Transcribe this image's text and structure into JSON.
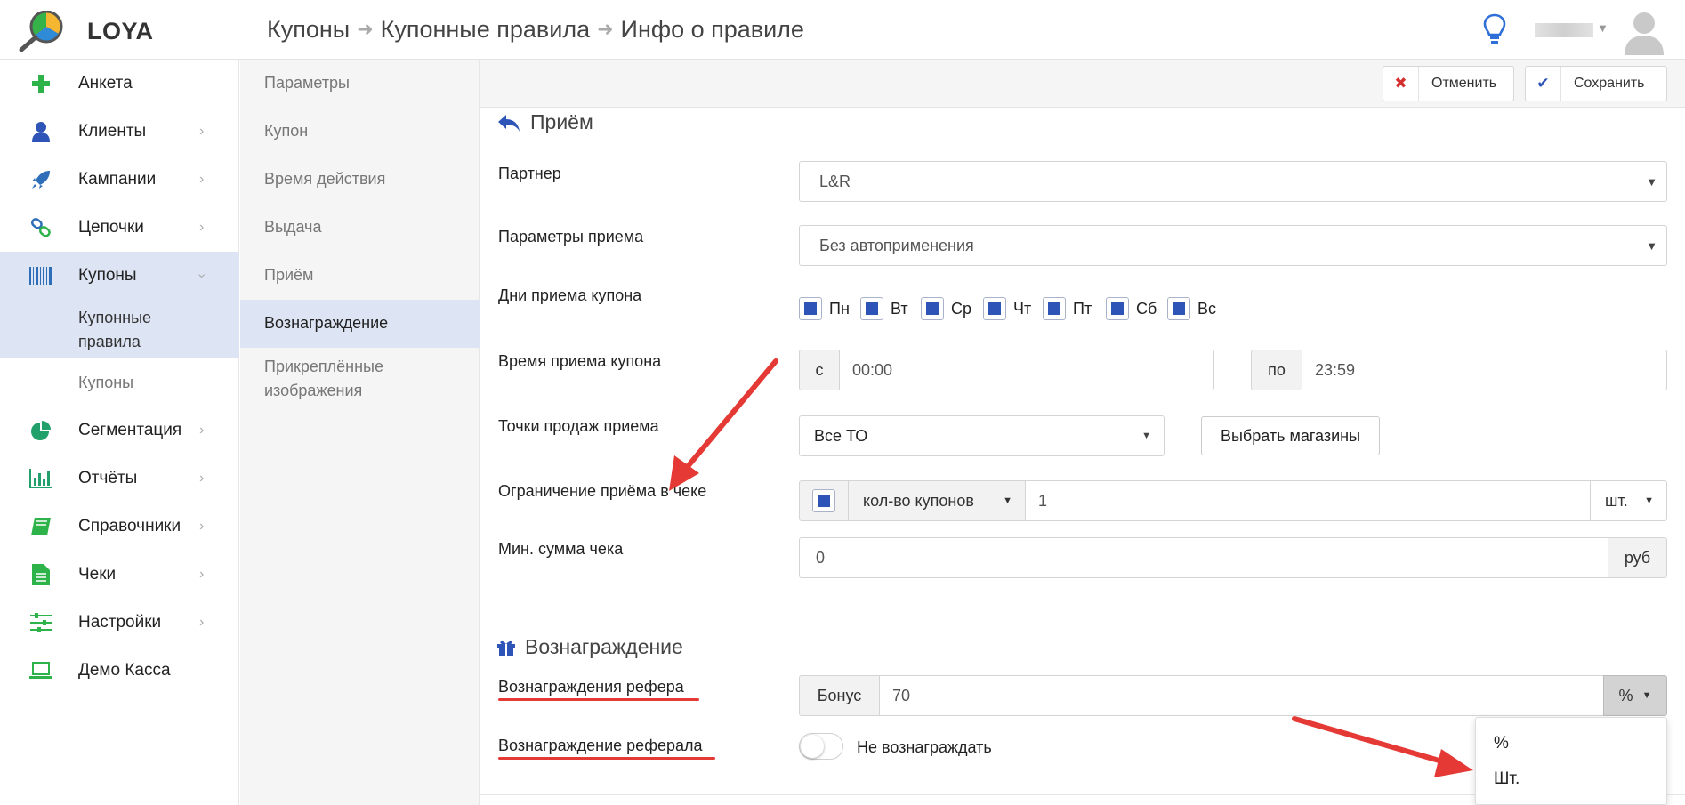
{
  "header": {
    "brand": "LOYA",
    "breadcrumb": [
      "Купоны",
      "Купонные правила",
      "Инфо о правиле"
    ]
  },
  "sidebar": {
    "items": [
      {
        "label": "Анкета",
        "icon": "plus-icon"
      },
      {
        "label": "Клиенты",
        "icon": "user-icon"
      },
      {
        "label": "Кампании",
        "icon": "rocket-icon"
      },
      {
        "label": "Цепочки",
        "icon": "link-icon"
      },
      {
        "label": "Купоны",
        "icon": "barcode-icon"
      },
      {
        "label": "Сегментация",
        "icon": "pie-chart-icon"
      },
      {
        "label": "Отчёты",
        "icon": "bar-chart-icon"
      },
      {
        "label": "Справочники",
        "icon": "book-icon"
      },
      {
        "label": "Чеки",
        "icon": "document-icon"
      },
      {
        "label": "Настройки",
        "icon": "sliders-icon"
      },
      {
        "label": "Демо Касса",
        "icon": "laptop-icon"
      }
    ],
    "sub_items": [
      "Купонные правила",
      "Купоны"
    ]
  },
  "subnav": {
    "items": [
      "Параметры",
      "Купон",
      "Время действия",
      "Выдача",
      "Приём",
      "Вознаграждение",
      "Прикреплённые изображения"
    ]
  },
  "toolbar": {
    "cancel_label": "Отменить",
    "save_label": "Сохранить"
  },
  "reception": {
    "title": "Приём",
    "partner_label": "Партнер",
    "partner_value": "L&R",
    "params_label": "Параметры приема",
    "params_value": "Без автоприменения",
    "days_label": "Дни приема купона",
    "days": [
      "Пн",
      "Вт",
      "Ср",
      "Чт",
      "Пт",
      "Сб",
      "Вс"
    ],
    "time_label": "Время приема купона",
    "time_from_prefix": "с",
    "time_from": "00:00",
    "time_to_prefix": "по",
    "time_to": "23:59",
    "points_label": "Точки продаж приема",
    "points_value": "Все ТО",
    "choose_stores": "Выбрать магазины",
    "limit_label": "Ограничение приёма в чеке",
    "limit_type": "кол-во купонов",
    "limit_value": "1",
    "limit_unit": "шт.",
    "min_sum_label": "Мин. сумма чека",
    "min_sum_value": "0",
    "min_sum_unit": "руб"
  },
  "reward": {
    "title": "Вознаграждение",
    "referrer_label": "Вознаграждения рефера",
    "bonus_prefix": "Бонус",
    "bonus_value": "70",
    "bonus_unit": "%",
    "referral_label": "Вознаграждение реферала",
    "referral_toggle_label": "Не вознаграждать",
    "dropdown_options": [
      "%",
      "Шт."
    ]
  },
  "colors": {
    "accent": "#2e54b8",
    "active_bg": "#dde5f4",
    "annotation_red": "#e53935"
  }
}
